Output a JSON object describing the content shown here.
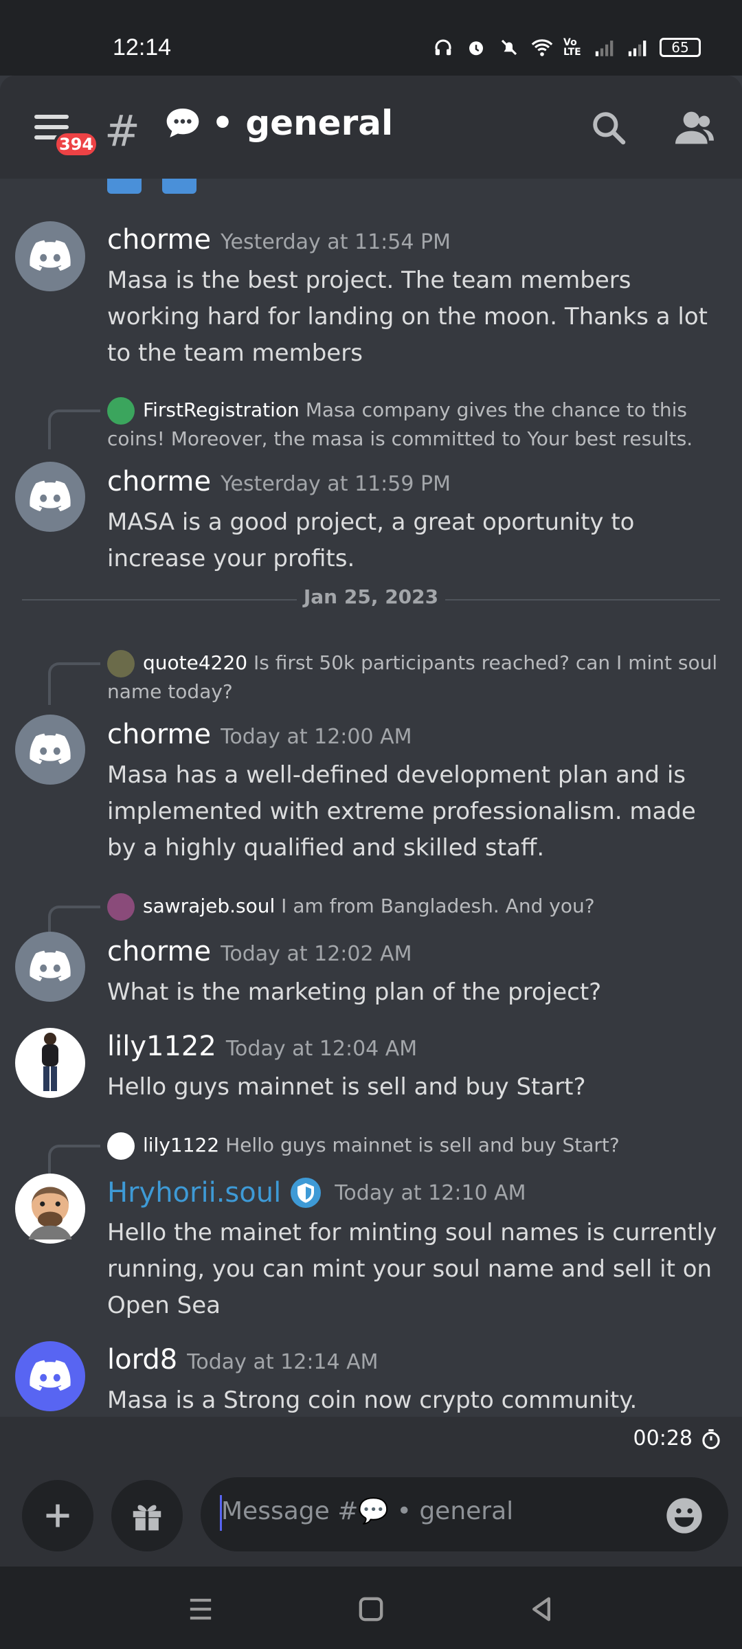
{
  "status_bar": {
    "time": "12:14",
    "battery": "65",
    "volte": "Vo LTE"
  },
  "header": {
    "badge_count": "394",
    "channel_name": "• general"
  },
  "messages": [
    {
      "user": "chorme",
      "time": "Yesterday at 11:54 PM",
      "text": "Masa is the best project. The team members working hard for landing on the moon. Thanks a lot to the team members"
    },
    {
      "reply_user": "FirstRegistration",
      "reply_text": "Masa company gives the chance to this coins! Moreover, the masa is committed to Your best results.",
      "user": "chorme",
      "time": "Yesterday at 11:59 PM",
      "text": "MASA is a good project, a great oportunity to increase your profits."
    },
    {
      "reply_user": "quote4220",
      "reply_text": "Is first 50k participants reached? can I mint soul name today?",
      "user": "chorme",
      "time": "Today at 12:00 AM",
      "text": "Masa has a well-defined development plan and is implemented with extreme professionalism. made by a highly qualified and skilled staff."
    },
    {
      "reply_user": "sawrajeb.soul",
      "reply_text": "I am from Bangladesh. And you?",
      "user": "chorme",
      "time": "Today at 12:02 AM",
      "text": "What is the marketing plan of the project?"
    },
    {
      "user": "lily1122",
      "time": "Today at 12:04 AM",
      "text": "Hello guys mainnet is sell and buy Start?"
    },
    {
      "reply_user": "lily1122",
      "reply_text": "Hello guys mainnet is sell and buy Start?",
      "user": "Hryhorii.soul",
      "time": "Today at 12:10 AM",
      "text": "Hello the mainet for minting soul names is currently running, you can mint your soul name and sell it on Open Sea"
    },
    {
      "user": "lord8",
      "time": "Today at 12:14 AM",
      "text": "Masa is a Strong coin now crypto community."
    }
  ],
  "date_divider": "Jan 25, 2023",
  "recording_timer": "00:28",
  "composer": {
    "placeholder": "Message #💬 • general"
  },
  "colors": {
    "accent": "#5865f2",
    "mod_name": "#3e9ad6",
    "badge": "#ed4245"
  }
}
